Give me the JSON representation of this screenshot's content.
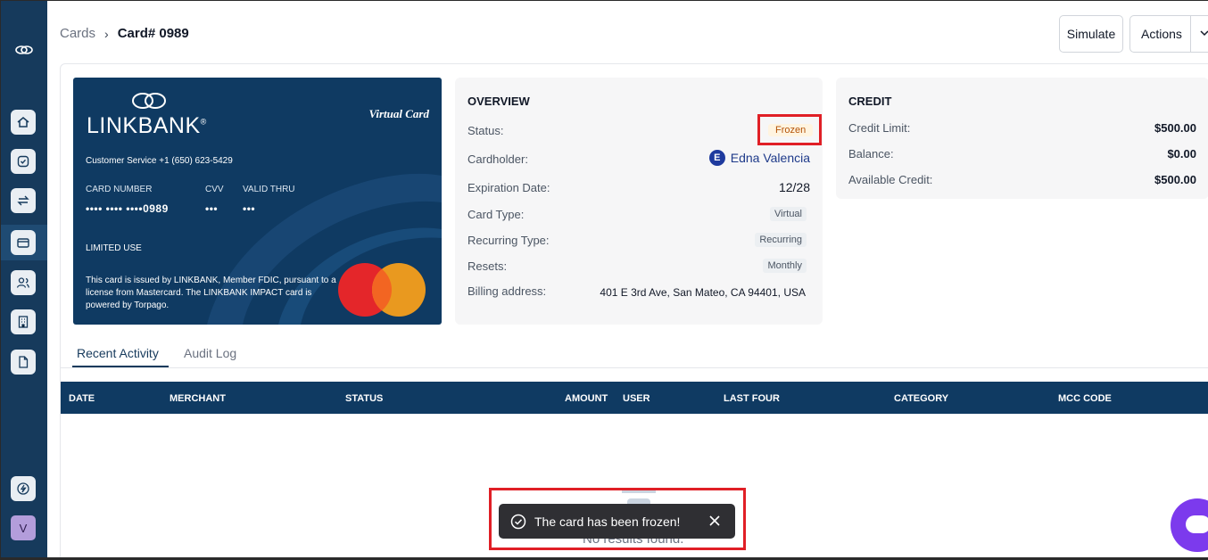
{
  "sidebar": {
    "icons": [
      "logo-icon",
      "home-icon",
      "check-circle-icon",
      "transfer-icon",
      "card-icon",
      "users-icon",
      "building-icon",
      "document-icon",
      "lightning-icon"
    ],
    "avatar_letter": "V"
  },
  "breadcrumb": {
    "parent": "Cards",
    "current": "Card# 0989"
  },
  "header": {
    "simulate_label": "Simulate",
    "actions_label": "Actions"
  },
  "card": {
    "brand": "LINKBANK",
    "registered": "®",
    "type_label": "Virtual Card",
    "customer_service": "Customer Service +1 (650) 623-5429",
    "number_label": "CARD NUMBER",
    "number_value": "•••• •••• ••••0989",
    "cvv_label": "CVV",
    "cvv_value": "•••",
    "valid_label": "VALID THRU",
    "valid_value": "•••",
    "limited_use": "LIMITED USE",
    "legal": "This card is issued by LINKBANK, Member FDIC, pursuant to a license from Mastercard. The LINKBANK IMPACT card is powered by Torpago."
  },
  "overview": {
    "title": "OVERVIEW",
    "status_label": "Status:",
    "status_value": "Frozen",
    "cardholder_label": "Cardholder:",
    "cardholder_initial": "E",
    "cardholder_name": "Edna Valencia",
    "expiration_label": "Expiration Date:",
    "expiration_value": "12/28",
    "card_type_label": "Card Type:",
    "card_type_value": "Virtual",
    "recurring_label": "Recurring Type:",
    "recurring_value": "Recurring",
    "resets_label": "Resets:",
    "resets_value": "Monthly",
    "billing_label": "Billing address:",
    "billing_value": "401 E 3rd Ave, San Mateo, CA 94401, USA"
  },
  "credit": {
    "title": "CREDIT",
    "limit_label": "Credit Limit:",
    "limit_value": "$500.00",
    "balance_label": "Balance:",
    "balance_value": "$0.00",
    "available_label": "Available Credit:",
    "available_value": "$500.00"
  },
  "tabs": {
    "recent": "Recent Activity",
    "audit": "Audit Log"
  },
  "table": {
    "columns": [
      "DATE",
      "MERCHANT",
      "STATUS",
      "AMOUNT",
      "USER",
      "LAST FOUR",
      "CATEGORY",
      "MCC CODE"
    ],
    "empty_text": "No results found."
  },
  "toast": {
    "message": "The card has been frozen!"
  },
  "colors": {
    "navy": "#163a5c",
    "card_blue": "#0f3a62",
    "highlight_red": "#e01f26",
    "frozen_text": "#b45309"
  }
}
